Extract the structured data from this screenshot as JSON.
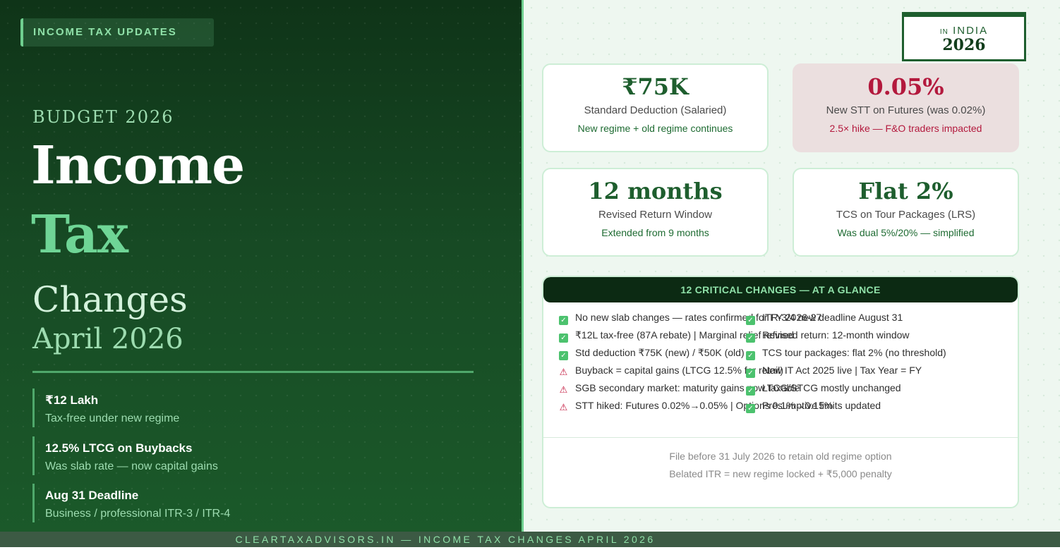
{
  "left": {
    "tag": "INCOME TAX UPDATES",
    "budget": "BUDGET 2026",
    "title_line1": "Income",
    "title_line2": "Tax",
    "title_line3": "Changes",
    "title_line4": "April 2026",
    "highlights": [
      {
        "heading": "₹12 Lakh",
        "sub": "Tax-free under new regime"
      },
      {
        "heading": "12.5% LTCG on Buybacks",
        "sub": "Was slab rate — now capital gains"
      },
      {
        "heading": "Aug 31 Deadline",
        "sub": "Business / professional ITR-3 / ITR-4"
      }
    ]
  },
  "badge": {
    "prefix": "IN",
    "country": "INDIA",
    "year": "2026"
  },
  "stats": [
    {
      "value": "₹75K",
      "label": "Standard Deduction (Salaried)",
      "note": "New regime + old regime continues"
    },
    {
      "value": "0.05%",
      "label": "New STT on Futures (was 0.02%)",
      "note": "2.5× hike — F&O traders impacted"
    },
    {
      "value": "12 months",
      "label": "Revised Return Window",
      "note": "Extended from 9 months"
    },
    {
      "value": "Flat 2%",
      "label": "TCS on Tour Packages (LRS)",
      "note": "Was dual 5%/20% — simplified"
    }
  ],
  "glance": {
    "title": "12 CRITICAL CHANGES — AT A GLANCE",
    "left_items": [
      {
        "icon": "check-icon",
        "text": "No new slab changes — rates confirmed for FY 2026-27"
      },
      {
        "icon": "check-icon",
        "text": "₹12L tax-free (87A rebate) | Marginal relief refined"
      },
      {
        "icon": "check-icon",
        "text": "Std deduction ₹75K (new) / ₹50K (old)"
      },
      {
        "icon": "warning-icon",
        "text": "Buyback = capital gains (LTCG 12.5% for retail)"
      },
      {
        "icon": "warning-icon",
        "text": "SGB secondary market: maturity gains now taxable"
      },
      {
        "icon": "warning-icon",
        "text": "STT hiked: Futures 0.02%→0.05% | Options 0.1%→0.15%"
      }
    ],
    "right_items": [
      {
        "icon": "check-icon",
        "text": "ITR-3/4 new deadline August 31"
      },
      {
        "icon": "check-icon",
        "text": "Revised return: 12-month window"
      },
      {
        "icon": "check-icon",
        "text": "TCS tour packages: flat 2% (no threshold)"
      },
      {
        "icon": "check-icon",
        "text": "New IT Act 2025 live | Tax Year = FY"
      },
      {
        "icon": "check-icon",
        "text": "LTCG/STCG mostly unchanged"
      },
      {
        "icon": "check-icon",
        "text": "Presumptive limits updated"
      }
    ],
    "notes": [
      "File before 31 July 2026 to retain old regime option",
      "Belated ITR = new regime locked + ₹5,000 penalty"
    ]
  },
  "footer": "CLEARTAXADVISORS.IN — INCOME TAX CHANGES APRIL 2026",
  "colors": {
    "accent": "#6fcf8f",
    "dark_green": "#153f1f",
    "alert": "#b3193d"
  }
}
